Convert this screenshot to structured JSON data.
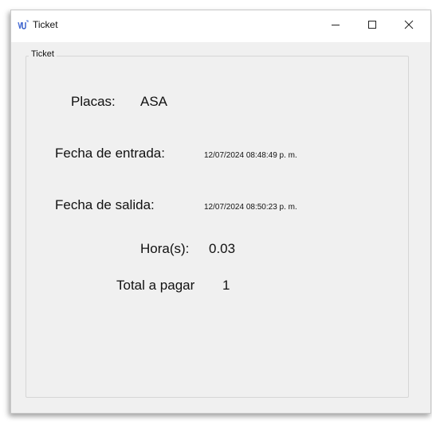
{
  "window": {
    "title": "Ticket"
  },
  "group": {
    "legend": "Ticket"
  },
  "ticket": {
    "placas_label": "Placas:",
    "placas_value": "ASA",
    "entrada_label": "Fecha de entrada:",
    "entrada_value": "12/07/2024 08:48:49 p. m.",
    "salida_label": "Fecha de salida:",
    "salida_value": "12/07/2024 08:50:23 p. m.",
    "horas_label": "Hora(s):",
    "horas_value": "0.03",
    "total_label": "Total a pagar",
    "total_value": "1"
  },
  "icons": {
    "app": "app-icon",
    "minimize": "minimize-icon",
    "maximize": "maximize-icon",
    "close": "close-icon"
  }
}
